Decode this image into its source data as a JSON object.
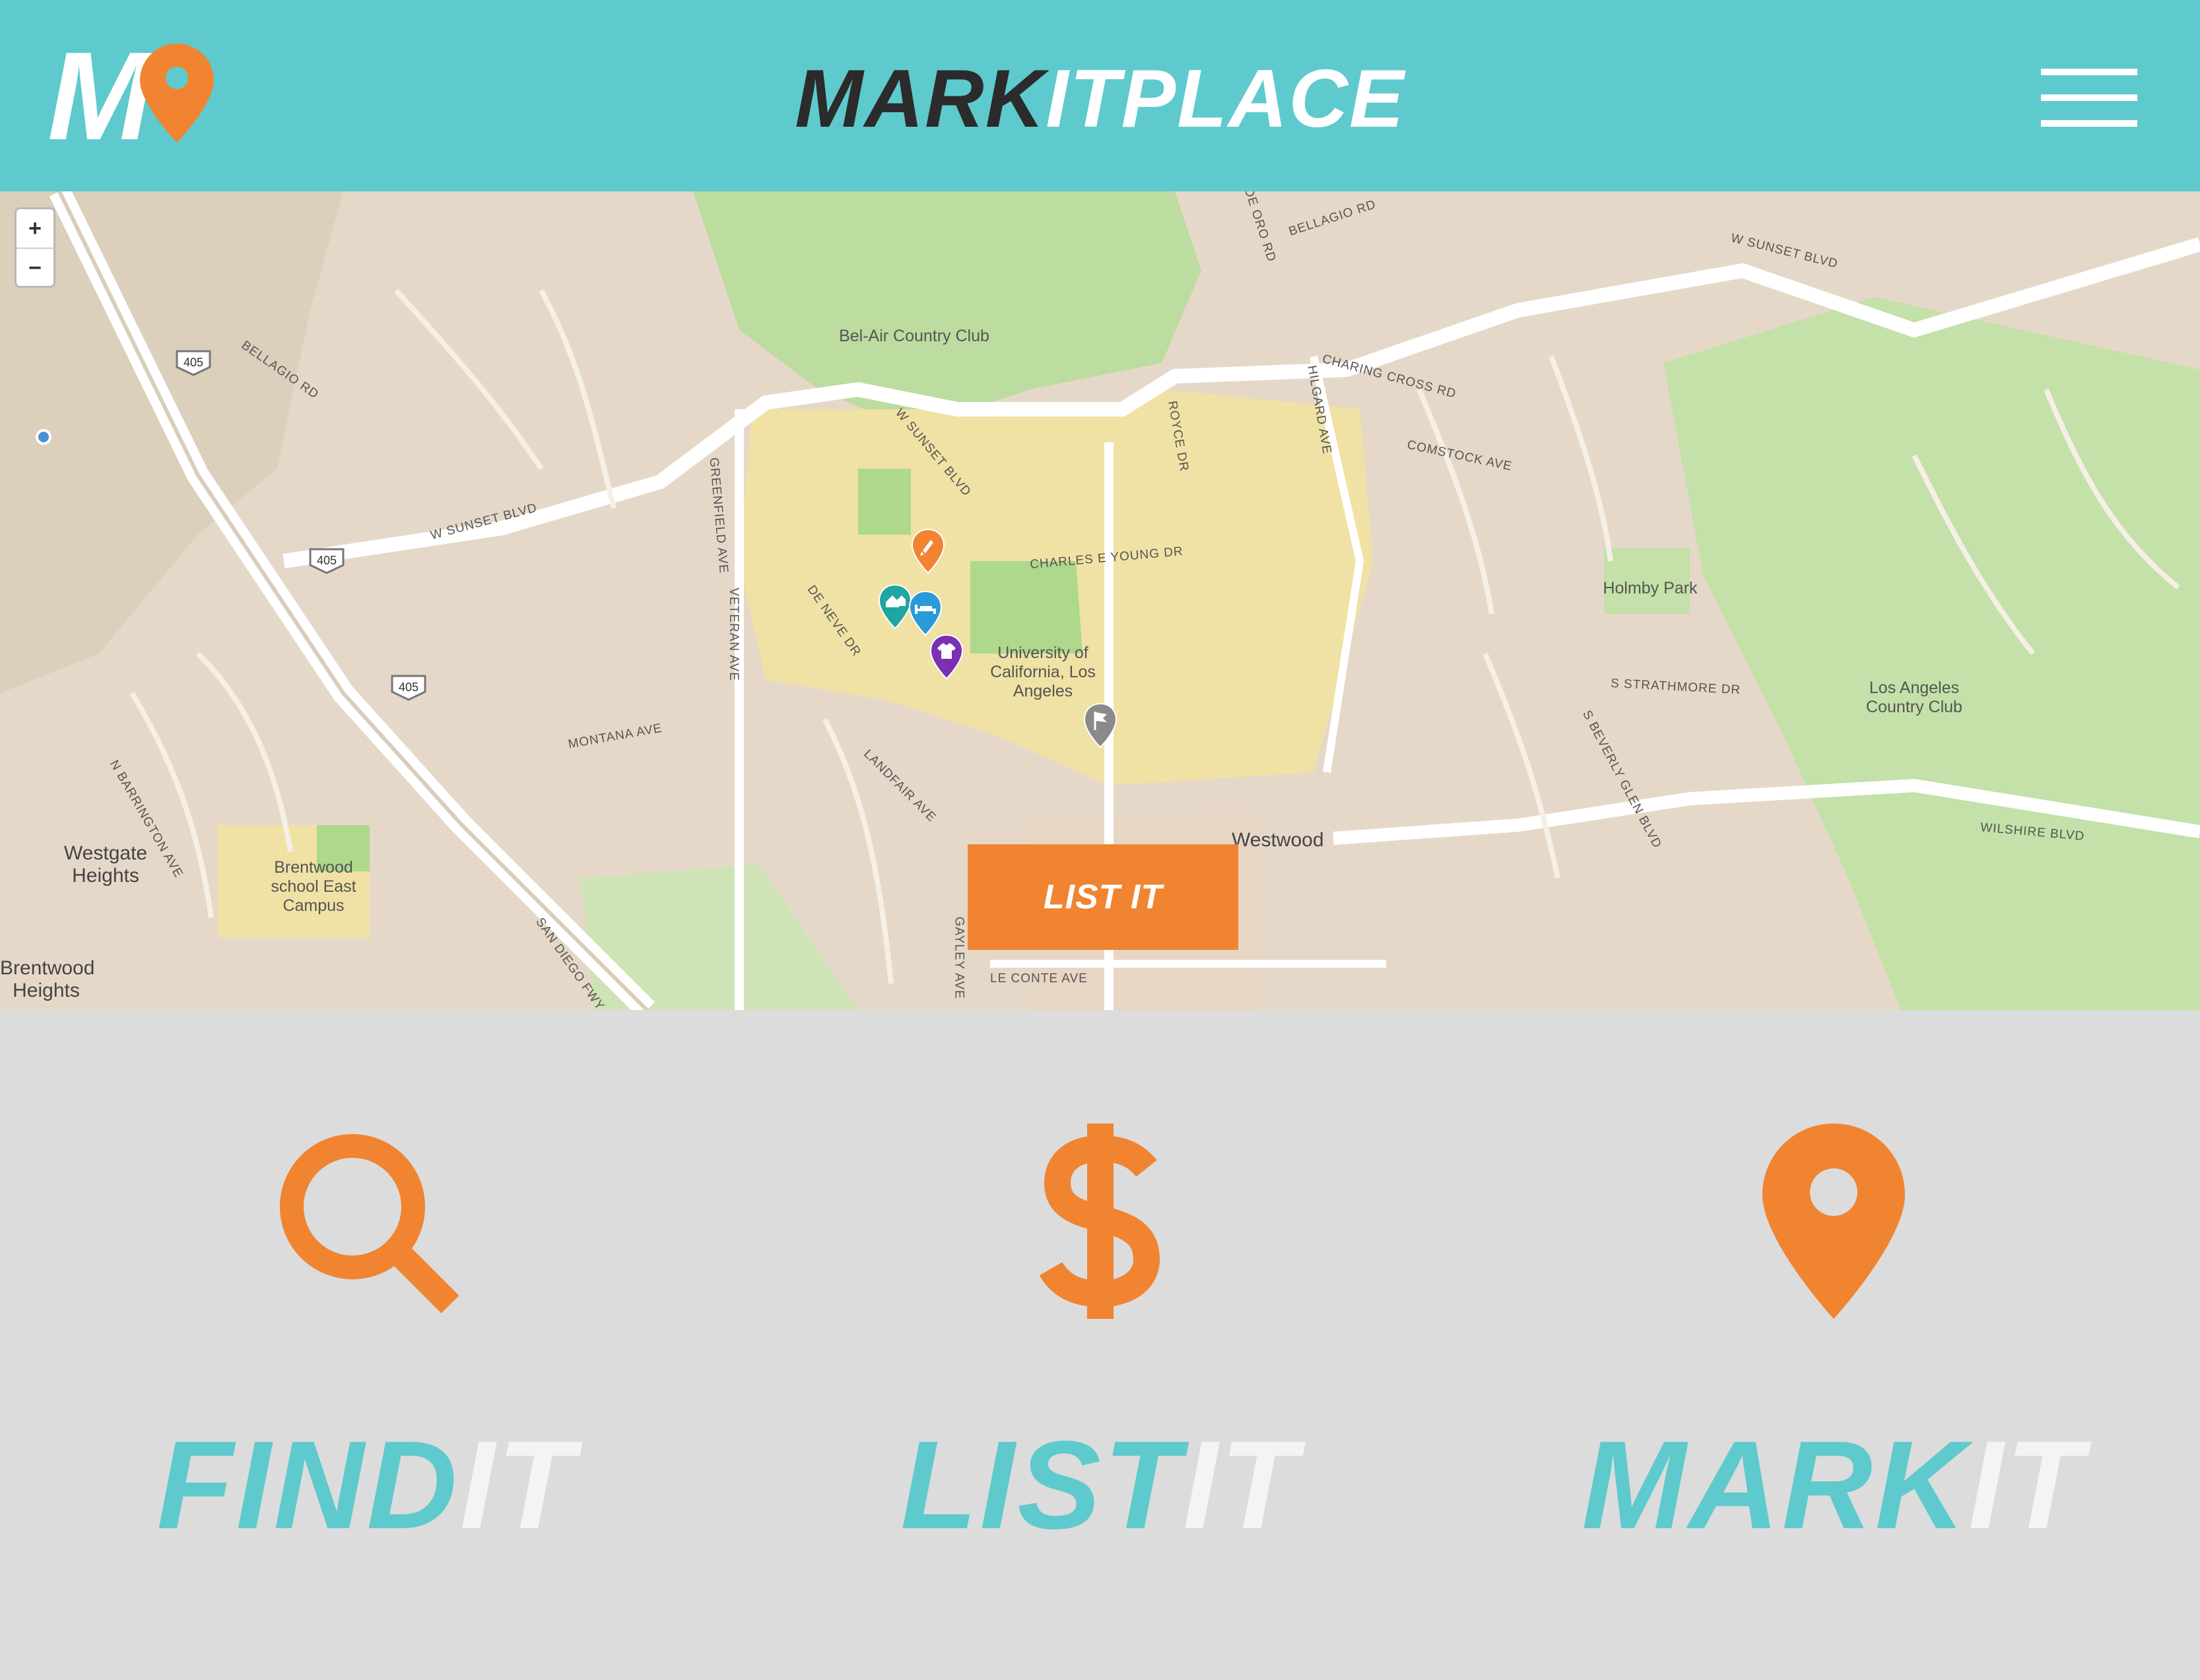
{
  "header": {
    "logo_letter": "M",
    "brand_dark": "MARK",
    "brand_light": "ITPLACE",
    "menu_icon": "hamburger-menu-icon"
  },
  "map": {
    "zoom_in": "+",
    "zoom_out": "−",
    "places": [
      {
        "name": "Bel-Air Country Club"
      },
      {
        "name": "University of California, Los Angeles"
      },
      {
        "name": "Holmby Park"
      },
      {
        "name": "Los Angeles Country Club"
      },
      {
        "name": "Westwood"
      },
      {
        "name": "Brentwood school East Campus"
      },
      {
        "name": "Westgate Heights"
      },
      {
        "name": "Brentwood Heights"
      }
    ],
    "streets": [
      "W SUNSET BLVD",
      "BELLAGIO RD",
      "CHARLES E YOUNG DR",
      "VETERAN AVE",
      "WILSHIRE BLVD",
      "LE CONTE AVE",
      "HILGARD AVE",
      "COMSTOCK AVE",
      "SAN DIEGO FWY",
      "MONTANA AVE",
      "LANDFAIR AVE",
      "GAYLEY AVE",
      "DE NEVE DR",
      "ROYCE DR",
      "CHARING CROSS RD",
      "S BEVERLY GLEN BLVD",
      "GREENFIELD AVE",
      "N BARRINGTON AVE",
      "S STRATHMORE DR",
      "DE ORO RD"
    ],
    "highway_shields": [
      "405",
      "405",
      "405"
    ],
    "markers": [
      {
        "name": "rocket-marker",
        "color": "#f08431"
      },
      {
        "name": "house-marker",
        "color": "#1fa6a1"
      },
      {
        "name": "bed-marker",
        "color": "#2a9ad8"
      },
      {
        "name": "shirt-marker",
        "color": "#7a2fb5"
      },
      {
        "name": "flag-marker",
        "color": "#8a8a8a"
      }
    ],
    "cta_label": "LIST IT"
  },
  "features": [
    {
      "icon": "search-icon",
      "title_a": "FIND",
      "title_b": "IT"
    },
    {
      "icon": "dollar-icon",
      "title_a": "LIST",
      "title_b": "IT"
    },
    {
      "icon": "map-pin-icon",
      "title_a": "MARK",
      "title_b": "IT"
    }
  ],
  "colors": {
    "teal": "#5ecacd",
    "orange": "#f08431",
    "dark": "#2b2b2b",
    "light_gray": "#dcdcdc"
  }
}
